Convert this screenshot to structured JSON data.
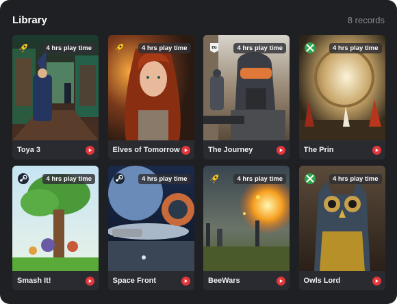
{
  "header": {
    "title": "Library",
    "count": "8 records"
  },
  "games": [
    {
      "title": "Toya 3",
      "playtime": "4 hrs play time",
      "platform_icon": "rocket-icon"
    },
    {
      "title": "Elves of Tomorrow",
      "playtime": "4 hrs play time",
      "platform_icon": "rocket-icon"
    },
    {
      "title": "The Journey",
      "playtime": "4 hrs play time",
      "platform_icon": "epic-games-icon"
    },
    {
      "title": "The Prin",
      "playtime": "4 hrs play time",
      "platform_icon": "xbox-icon"
    },
    {
      "title": "Smash It!",
      "playtime": "4 hrs play time",
      "platform_icon": "steam-icon"
    },
    {
      "title": "Space Front",
      "playtime": "4 hrs play time",
      "platform_icon": "steam-icon"
    },
    {
      "title": "BeeWars",
      "playtime": "4 hrs play time",
      "platform_icon": "rocket-icon"
    },
    {
      "title": "Owls Lord",
      "playtime": "4 hrs play time",
      "platform_icon": "xbox-icon"
    }
  ],
  "colors": {
    "panel": "#1f2024",
    "card_footer": "#2a2b31",
    "play_button": "#e3363c",
    "muted_text": "#8a8b92"
  }
}
